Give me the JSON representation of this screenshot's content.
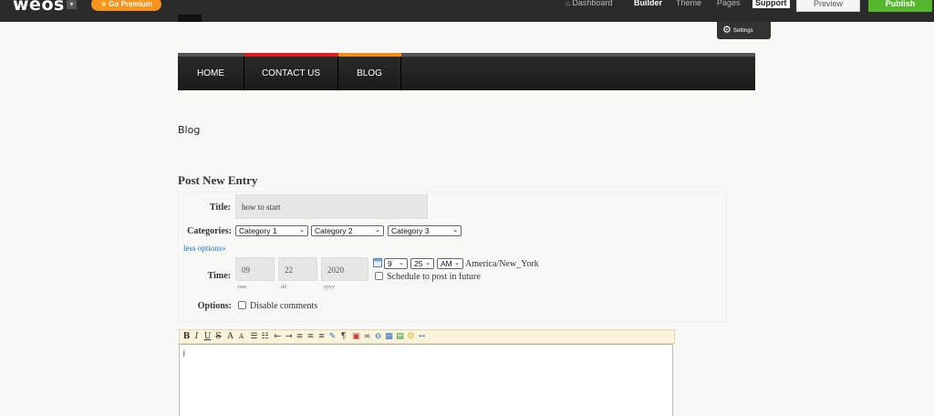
{
  "topbar": {
    "logo": "weos",
    "go_premium": "Go Premium",
    "nav": [
      "Dashboard",
      "Builder",
      "Theme",
      "Pages"
    ],
    "support": "Support",
    "preview": "Preview",
    "publish": "Publish"
  },
  "settings_popup": {
    "label": "Settings"
  },
  "site_nav": {
    "items": [
      "HOME",
      "CONTACT US",
      "BLOG"
    ],
    "accent_colors": [
      "#e02020",
      "#f28c1a"
    ]
  },
  "page": {
    "heading": "Blog",
    "post_heading": "Post New Entry"
  },
  "form": {
    "title_label": "Title:",
    "title_value": "how to start",
    "categories_label": "Categories:",
    "categories": [
      "Category 1",
      "Category 2",
      "Category 3"
    ],
    "less_options": "less options»",
    "time_label": "Time:",
    "month": "09",
    "day": "22",
    "year": "2020",
    "month_hint": "mm",
    "day_hint": "dd",
    "year_hint": "yyyy",
    "hour": "9",
    "minute": "25",
    "ampm": "AM",
    "timezone": "America/New_York",
    "schedule_label": "Schedule to post in future",
    "options_label": "Options:",
    "disable_comments": "Disable comments"
  },
  "editor": {
    "toolbar": [
      "B",
      "I",
      "U",
      "S"
    ],
    "content": "j"
  }
}
